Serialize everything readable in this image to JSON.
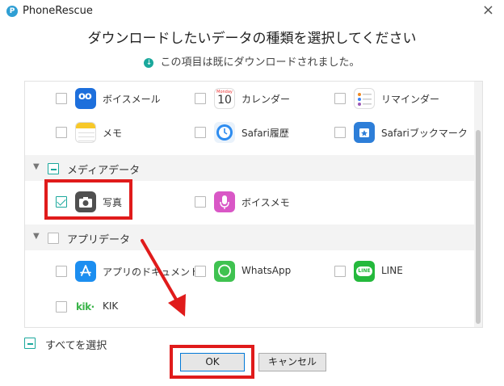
{
  "window": {
    "app_title": "PhoneRescue",
    "close_glyph": "×"
  },
  "dialog": {
    "heading": "ダウンロードしたいデータの種類を選択してください",
    "subtitle": "この項目は既にダウンロードされました。"
  },
  "groups": [
    {
      "label": "メディアデータ",
      "state": "partial",
      "items": [
        {
          "label": "写真",
          "icon": "camera-icon",
          "checked": true
        },
        {
          "label": "ボイスメモ",
          "icon": "microphone-icon",
          "checked": false
        }
      ]
    },
    {
      "label": "アプリデータ",
      "state": "unchecked",
      "items": [
        {
          "label": "アプリのドキュメント",
          "icon": "app-store-icon",
          "checked": false
        },
        {
          "label": "WhatsApp",
          "icon": "whatsapp-icon",
          "checked": false
        },
        {
          "label": "LINE",
          "icon": "line-icon",
          "checked": false
        },
        {
          "label": "KIK",
          "icon": "kik-icon",
          "checked": false
        }
      ]
    }
  ],
  "personal_items": [
    {
      "label": "ボイスメール",
      "icon": "voicemail-icon",
      "checked": false
    },
    {
      "label": "カレンダー",
      "icon": "calendar-icon",
      "checked": false
    },
    {
      "label": "リマインダー",
      "icon": "reminders-icon",
      "checked": false
    },
    {
      "label": "メモ",
      "icon": "notes-icon",
      "checked": false
    },
    {
      "label": "Safari履歴",
      "icon": "safari-history-icon",
      "checked": false
    },
    {
      "label": "Safariブックマーク",
      "icon": "safari-bookmark-icon",
      "checked": false
    }
  ],
  "icon_text": {
    "calendar_weekday": "Monday",
    "calendar_day": "10",
    "line_badge": "LINE",
    "kik_logo": "kik·"
  },
  "footer": {
    "select_all_label": "すべてを選択",
    "ok_label": "OK",
    "cancel_label": "キャンセル"
  },
  "colors": {
    "accent": "#1aa89c",
    "highlight": "#e01b1b",
    "ok_border": "#0078d7"
  }
}
